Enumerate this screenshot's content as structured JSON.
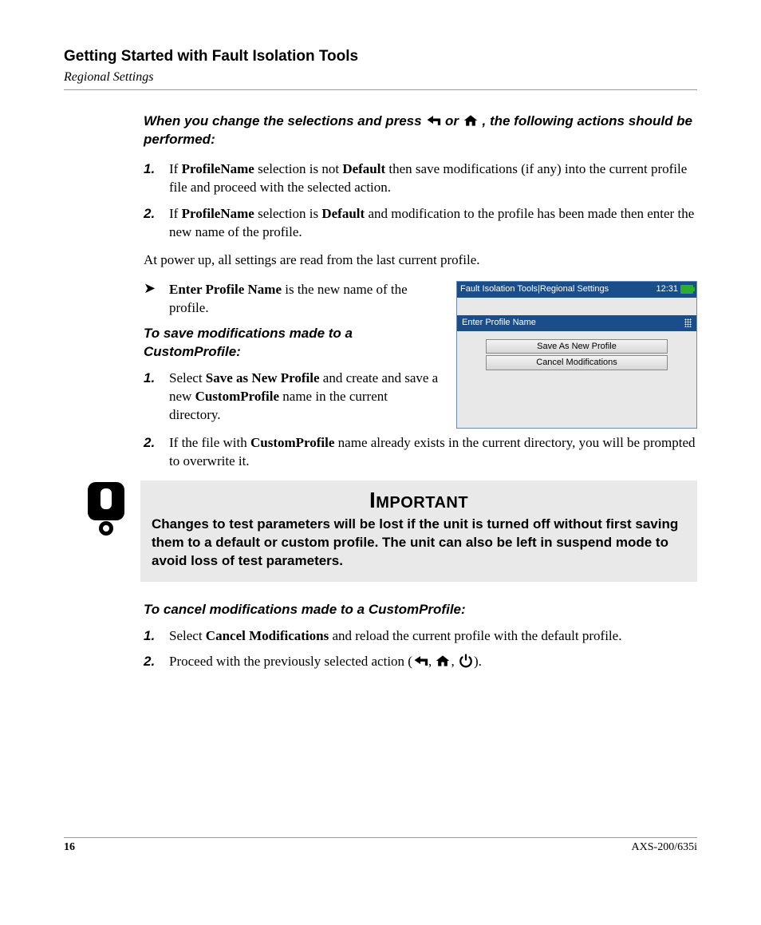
{
  "header": {
    "title": "Getting Started with Fault Isolation Tools",
    "subtitle": "Regional Settings"
  },
  "intro": {
    "pre": "When you change the selections and press ",
    "mid": " or ",
    "post": ", the following actions should be performed:"
  },
  "list1": {
    "n1": "1.",
    "i1a": "If ",
    "i1b": "ProfileName",
    "i1c": " selection is not ",
    "i1d": "Default",
    "i1e": " then save modifications (if any) into the current profile file and proceed with the selected action.",
    "n2": "2.",
    "i2a": "If ",
    "i2b": "ProfileName",
    "i2c": " selection is ",
    "i2d": "Default",
    "i2e": " and modification to the profile has been made then enter the new name of the profile."
  },
  "para_powerup": "At power up, all settings are read from the last current profile.",
  "bullet": {
    "b1": "Enter Profile Name",
    "b2": " is the new name of the profile."
  },
  "subhead_save": "To save modifications made to a CustomProfile:",
  "list2": {
    "n1": "1.",
    "i1a": "Select ",
    "i1b": "Save as New Profile",
    "i1c": " and create and save a new ",
    "i1d": "CustomProfile",
    "i1e": " name in the current directory.",
    "n2": "2.",
    "i2a": "If the file with ",
    "i2b": "CustomProfile",
    "i2c": " name already exists in the current directory, you will be prompted to overwrite it."
  },
  "device": {
    "title": "Fault Isolation Tools|Regional Settings",
    "time": "12:31",
    "field": "Enter Profile Name",
    "btn1": "Save As New Profile",
    "btn2": "Cancel Modifications"
  },
  "important": {
    "title": "Important",
    "body": "Changes to test parameters will be lost if the unit is turned off without first saving them to a default or custom profile. The unit can also be left in suspend mode to avoid loss of test parameters."
  },
  "subhead_cancel": "To cancel modifications made to a CustomProfile:",
  "list3": {
    "n1": "1.",
    "i1a": "Select ",
    "i1b": "Cancel Modifications",
    "i1c": " and reload the current profile with the default profile.",
    "n2": "2.",
    "i2a": "Proceed with the previously selected action (",
    "i2b": ", ",
    "i2c": ", ",
    "i2d": ")."
  },
  "footer": {
    "page": "16",
    "model": "AXS-200/635i"
  }
}
